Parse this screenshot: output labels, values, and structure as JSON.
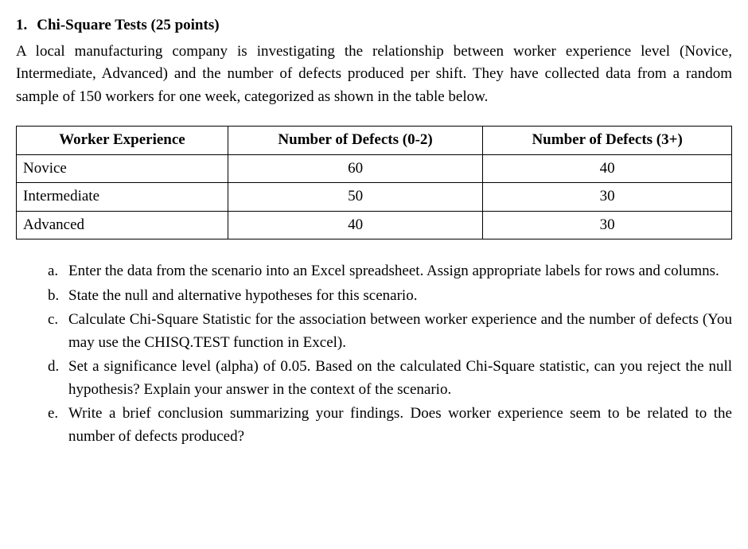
{
  "question": {
    "number": "1.",
    "title": "Chi-Square Tests (25 points)",
    "intro": "A local manufacturing company is investigating the relationship between worker experience level (Novice, Intermediate, Advanced) and the number of defects produced per shift. They have collected data from a random sample of 150 workers for one week, categorized as shown in the table below."
  },
  "table": {
    "headers": {
      "col1": "Worker Experience",
      "col2": "Number of Defects (0-2)",
      "col3": "Number of Defects (3+)"
    },
    "rows": [
      {
        "label": "Novice",
        "defects_low": "60",
        "defects_high": "40"
      },
      {
        "label": "Intermediate",
        "defects_low": "50",
        "defects_high": "30"
      },
      {
        "label": "Advanced",
        "defects_low": "40",
        "defects_high": "30"
      }
    ]
  },
  "subquestions": [
    {
      "marker": "a.",
      "text": "Enter the data from the scenario into an Excel spreadsheet. Assign appropriate labels for rows and columns."
    },
    {
      "marker": "b.",
      "text": "State the null and alternative hypotheses for this scenario."
    },
    {
      "marker": "c.",
      "text": "Calculate Chi-Square Statistic for the association between worker experience and the number of defects (You may use the CHISQ.TEST function in Excel)."
    },
    {
      "marker": "d.",
      "text": "Set a significance level (alpha) of 0.05. Based on the calculated Chi-Square statistic, can you reject the null hypothesis? Explain your answer in the context of the scenario."
    },
    {
      "marker": "e.",
      "text": "Write a brief conclusion summarizing your findings. Does worker experience seem to be related to the number of defects produced?"
    }
  ]
}
